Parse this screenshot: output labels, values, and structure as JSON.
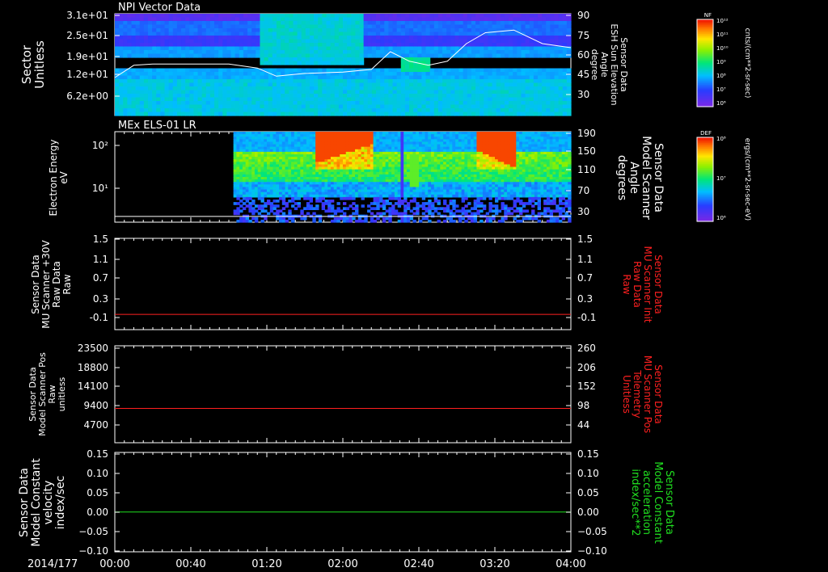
{
  "chart_data": [
    {
      "type": "heatmap",
      "title": "NPI Vector Data",
      "ylabel": [
        "Sector",
        "Unitless"
      ],
      "yticks": [
        "3.1e+01",
        "2.5e+01",
        "1.9e+01",
        "1.2e+01",
        "6.2e+00"
      ],
      "y2label": [
        "Sensor Data",
        "ESH Sun Elevation",
        "Angle",
        "degree"
      ],
      "y2ticks": [
        "90",
        "75",
        "60",
        "45",
        "30"
      ],
      "ylim_right": [
        15,
        90
      ],
      "colorbar": {
        "label": "NF",
        "unit": "cnts/(cm**2-sr-sec)",
        "ticks": [
          "10¹²",
          "10¹¹",
          "10¹⁰",
          "10⁹",
          "10⁸",
          "10⁷",
          "10⁶"
        ]
      },
      "overlay_series": {
        "name": "Sensor Data ESH Sun Elevation Angle",
        "x_min": [
          0,
          10,
          20,
          40,
          60,
          75,
          85,
          100,
          120,
          135,
          145,
          155,
          165,
          175,
          185,
          195,
          210,
          225,
          240
        ],
        "y_deg": [
          43,
          52,
          53,
          53,
          53,
          50,
          44,
          46,
          47,
          49,
          62,
          55,
          52,
          55,
          68,
          76,
          78,
          68,
          65
        ]
      }
    },
    {
      "type": "heatmap",
      "title": "MEx ELS-01 LR",
      "ylabel": [
        "Electron Energy",
        "eV"
      ],
      "yticks": [
        "10²",
        "10¹"
      ],
      "y2label": [
        "Sensor Data",
        "Model Scanner",
        "Angle",
        "degrees"
      ],
      "y2ticks": [
        "190",
        "150",
        "110",
        "70",
        "30"
      ],
      "ylim_right": [
        0,
        190
      ],
      "colorbar": {
        "label": "DEF",
        "unit": "ergs/(cm**2-sr-sec-eV)",
        "ticks": [
          "10⁸",
          "10⁷",
          "10⁶"
        ]
      },
      "overlay_series": {
        "name": "Sensor Data Model Scanner Angle",
        "y_deg": 2
      }
    },
    {
      "type": "line",
      "ylabel": [
        "Sensor Data",
        "MU Scanner +30V",
        "Raw Data",
        "Raw"
      ],
      "yticks": [
        "1.5",
        "1.1",
        "0.7",
        "0.3",
        "-0.1"
      ],
      "ylim": [
        -0.3,
        1.5
      ],
      "y2label": [
        "Sensor Data",
        "MU Scanner Init",
        "Raw Data",
        "Raw"
      ],
      "y2ticks": [
        "1.5",
        "1.1",
        "0.7",
        "0.3",
        "-0.1"
      ],
      "series": [
        {
          "name": "Sensor Data MU Scanner Init Raw Data",
          "color": "#ff2020",
          "value": 0.0
        }
      ]
    },
    {
      "type": "line",
      "ylabel": [
        "Sensor Data",
        "Model Scanner Pos",
        "Raw",
        "unitless"
      ],
      "yticks": [
        "23500",
        "18800",
        "14100",
        "9400",
        "4700"
      ],
      "ylim": [
        0,
        23500
      ],
      "y2label": [
        "Sensor Data",
        "MU Scanner Pos",
        "Telemetry",
        "Unitless"
      ],
      "y2ticks": [
        "260",
        "206",
        "152",
        "98",
        "44"
      ],
      "y2lim": [
        0,
        260
      ],
      "series": [
        {
          "name": "Sensor Data MU Scanner Pos Telemetry",
          "color": "#ff2020",
          "value": 92
        }
      ]
    },
    {
      "type": "line",
      "ylabel": [
        "Sensor Data",
        "Model Constant",
        "velocity",
        "index/sec"
      ],
      "yticks": [
        "0.15",
        "0.10",
        "0.05",
        "0.00",
        "−0.05",
        "−0.10"
      ],
      "ylim": [
        -0.1,
        0.15
      ],
      "y2label": [
        "Sensor Data",
        "Model Constant",
        "acceleration",
        "index/sec**2"
      ],
      "y2ticks": [
        "0.15",
        "0.10",
        "0.05",
        "0.00",
        "−0.05",
        "−0.10"
      ],
      "series": [
        {
          "name": "Sensor Data Model Constant acceleration",
          "color": "#20e020",
          "value": 0.0
        }
      ]
    }
  ],
  "xaxis": {
    "date": "2014/177",
    "ticks": [
      "00:00",
      "00:40",
      "01:20",
      "02:00",
      "02:40",
      "03:20",
      "04:00"
    ],
    "range_min": [
      0,
      240
    ]
  },
  "colors": {
    "background": "#000000",
    "foreground": "#ffffff",
    "red_label": "#ff2020",
    "green_label": "#20e020"
  }
}
